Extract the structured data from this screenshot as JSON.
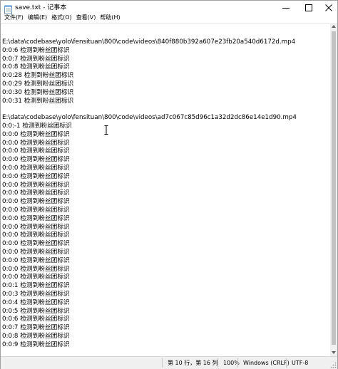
{
  "window": {
    "title": "save.txt - 记事本",
    "app_icon": "notepad-icon",
    "controls": {
      "minimize": "minimize-icon",
      "maximize": "maximize-icon",
      "close": "close-icon"
    }
  },
  "menu": [
    {
      "label": "文件(F)"
    },
    {
      "label": "编辑(E)"
    },
    {
      "label": "格式(O)"
    },
    {
      "label": "查看(V)"
    },
    {
      "label": "帮助(H)"
    }
  ],
  "editor": {
    "lines": [
      "E:\\data\\codebase\\yolo\\fensituan\\800\\code\\videos\\840f880b392a607e23fb20a540d6172d.mp4",
      "0:0:6 检测到粉丝团标识",
      "0:0:7 检测到粉丝团标识",
      "0:0:8 检测到粉丝团标识",
      "0:0:28 检测到粉丝团标识",
      "0:0:29 检测到粉丝团标识",
      "0:0:30 检测到粉丝团标识",
      "0:0:31 检测到粉丝团标识",
      "",
      "E:\\data\\codebase\\yolo\\fensituan\\800\\code\\videos\\ad7c067c85d96c1a32d2dc86e14e1d90.mp4",
      "0:0:-1 检测到粉丝团标识",
      "0:0:0 检测到粉丝团标识",
      "0:0:0 检测到粉丝团标识",
      "0:0:0 检测到粉丝团标识",
      "0:0:0 检测到粉丝团标识",
      "0:0:0 检测到粉丝团标识",
      "0:0:0 检测到粉丝团标识",
      "0:0:0 检测到粉丝团标识",
      "0:0:0 检测到粉丝团标识",
      "0:0:0 检测到粉丝团标识",
      "0:0:0 检测到粉丝团标识",
      "0:0:0 检测到粉丝团标识",
      "0:0:0 检测到粉丝团标识",
      "0:0:0 检测到粉丝团标识",
      "0:0:0 检测到粉丝团标识",
      "0:0:0 检测到粉丝团标识",
      "0:0:0 检测到粉丝团标识",
      "0:0:0 检测到粉丝团标识",
      "0:0:0 检测到粉丝团标识",
      "0:0:1 检测到粉丝团标识",
      "0:0:3 检测到粉丝团标识",
      "0:0:4 检测到粉丝团标识",
      "0:0:5 检测到粉丝团标识",
      "0:0:6 检测到粉丝团标识",
      "0:0:7 检测到粉丝团标识",
      "0:0:8 检测到粉丝团标识",
      "0:0:9 检测到粉丝团标识"
    ]
  },
  "status": {
    "position": "第 10 行，第 16 列",
    "zoom": "100%",
    "line_ending": "Windows (CRLF)",
    "encoding": "UTF-8"
  }
}
